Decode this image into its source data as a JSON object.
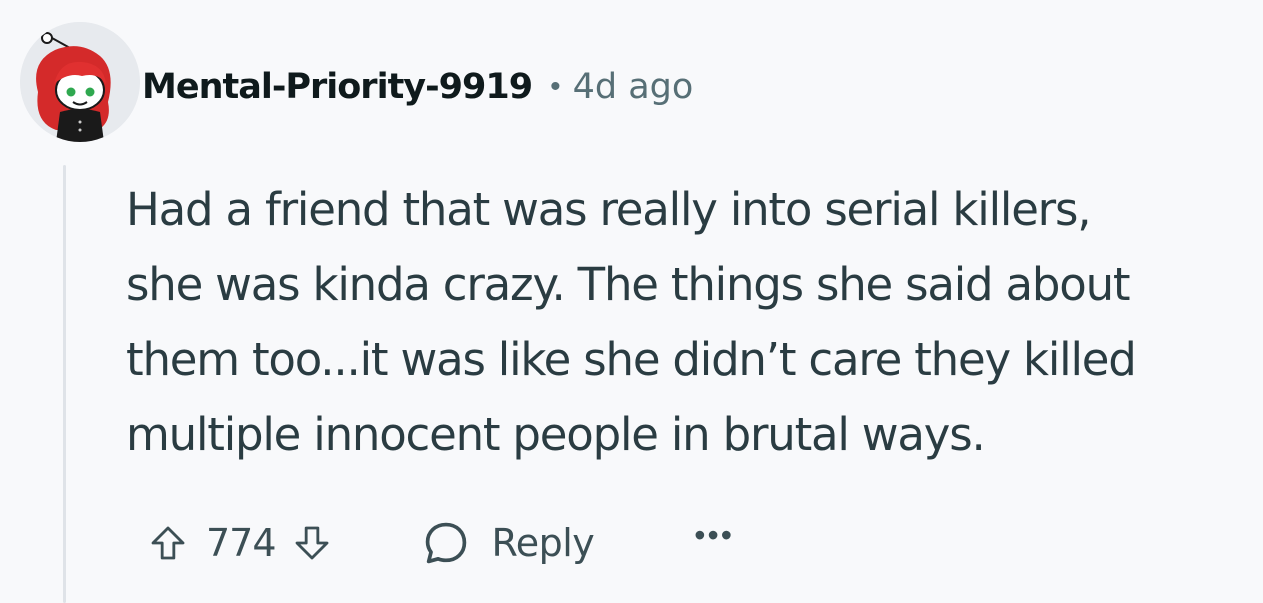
{
  "comment": {
    "author": "Mental-Priority-9919",
    "separator": "•",
    "timestamp": "4d ago",
    "body": "Had a friend that was really into serial killers,\nshe was kinda crazy. The things she said about\nthem too...it was like she didn’t care they killed\nmultiple innocent people in brutal ways.",
    "score": "774",
    "reply_label": "Reply",
    "more_label": "•••"
  },
  "icons": {
    "avatar": "snoo-avatar-red-hair",
    "upvote": "upvote-arrow-icon",
    "downvote": "downvote-arrow-icon",
    "reply": "comment-bubble-icon",
    "more": "more-options-icon"
  },
  "colors": {
    "background": "#f8f9fb",
    "author": "#0f1a1c",
    "meta": "#576f76",
    "body_text": "#2a3c42",
    "thread_line": "#dfe3e8",
    "avatar_hair": "#d42a2a"
  }
}
